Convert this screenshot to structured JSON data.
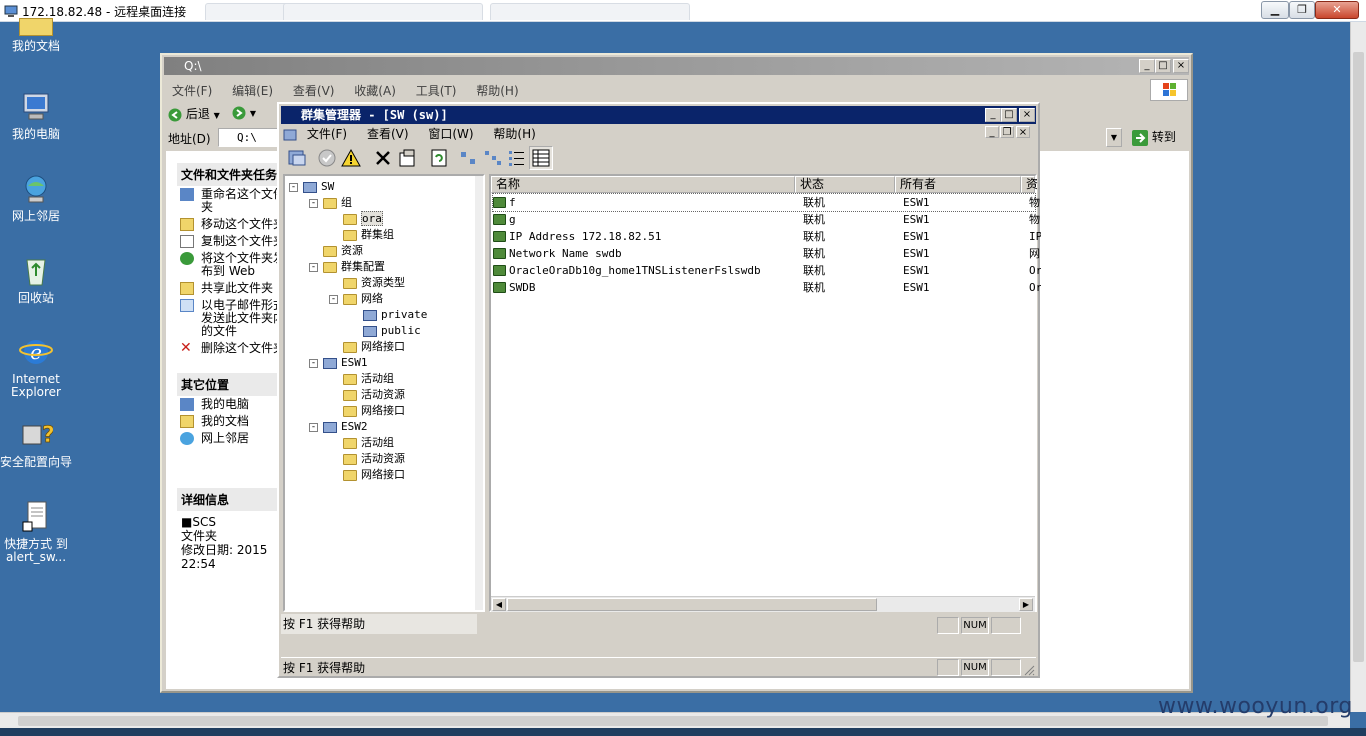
{
  "rdp": {
    "title": "172.18.82.48 - 远程桌面连接",
    "tab_count": 3
  },
  "desktop_icons": [
    {
      "label": "我的文档",
      "icon": "my-documents-icon"
    },
    {
      "label": "我的电脑",
      "icon": "my-computer-icon"
    },
    {
      "label": "网上邻居",
      "icon": "network-places-icon"
    },
    {
      "label": "回收站",
      "icon": "recycle-bin-icon"
    },
    {
      "label": "Internet Explorer",
      "icon": "ie-icon"
    },
    {
      "label": "安全配置向导",
      "icon": "security-wizard-icon"
    },
    {
      "label": "快捷方式 到 alert_sw...",
      "icon": "shortcut-file-icon"
    }
  ],
  "explorer": {
    "title": "Q:\\",
    "menu": [
      "文件(F)",
      "编辑(E)",
      "查看(V)",
      "收藏(A)",
      "工具(T)",
      "帮助(H)"
    ],
    "back_label": "后退",
    "address_label": "地址(D)",
    "address_value": "Q:\\",
    "go_label": "转到",
    "tasks_header": "文件和文件夹任务",
    "tasks": [
      "重命名这个文件夹",
      "移动这个文件夹",
      "复制这个文件夹",
      "将这个文件夹发布到 Web",
      "共享此文件夹",
      "以电子邮件形式发送此文件夹内的文件",
      "删除这个文件夹"
    ],
    "other_places_header": "其它位置",
    "other_places": [
      "我的电脑",
      "我的文档",
      "网上邻居"
    ],
    "details_header": "详细信息",
    "details_name": "■SCS",
    "details_type": "文件夹",
    "details_modified": "修改日期: 2015",
    "details_time": "22:54"
  },
  "cluster_manager": {
    "title": "群集管理器 - [SW (sw)]",
    "menu": [
      "文件(F)",
      "查看(V)",
      "窗口(W)",
      "帮助(H)"
    ],
    "tree": [
      {
        "label": "SW",
        "icon": "cluster",
        "depth": 0,
        "expander": "-"
      },
      {
        "label": "组",
        "icon": "folder",
        "depth": 1,
        "expander": "-"
      },
      {
        "label": "ora",
        "icon": "folder-group",
        "depth": 2,
        "expander": ""
      },
      {
        "label": "群集组",
        "icon": "folder-group",
        "depth": 2,
        "expander": ""
      },
      {
        "label": "资源",
        "icon": "folder",
        "depth": 1,
        "expander": ""
      },
      {
        "label": "群集配置",
        "icon": "folder",
        "depth": 1,
        "expander": "-"
      },
      {
        "label": "资源类型",
        "icon": "folder",
        "depth": 2,
        "expander": ""
      },
      {
        "label": "网络",
        "icon": "folder",
        "depth": 2,
        "expander": "-"
      },
      {
        "label": "private",
        "icon": "network",
        "depth": 3,
        "expander": ""
      },
      {
        "label": "public",
        "icon": "network",
        "depth": 3,
        "expander": ""
      },
      {
        "label": "网络接口",
        "icon": "folder",
        "depth": 2,
        "expander": ""
      },
      {
        "label": "ESW1",
        "icon": "node",
        "depth": 1,
        "expander": "-"
      },
      {
        "label": "活动组",
        "icon": "folder",
        "depth": 2,
        "expander": ""
      },
      {
        "label": "活动资源",
        "icon": "folder",
        "depth": 2,
        "expander": ""
      },
      {
        "label": "网络接口",
        "icon": "folder",
        "depth": 2,
        "expander": ""
      },
      {
        "label": "ESW2",
        "icon": "node",
        "depth": 1,
        "expander": "-"
      },
      {
        "label": "活动组",
        "icon": "folder",
        "depth": 2,
        "expander": ""
      },
      {
        "label": "活动资源",
        "icon": "folder",
        "depth": 2,
        "expander": ""
      },
      {
        "label": "网络接口",
        "icon": "folder",
        "depth": 2,
        "expander": ""
      }
    ],
    "columns": [
      "名称",
      "状态",
      "所有者",
      "资"
    ],
    "rows": [
      {
        "name": "f",
        "state": "联机",
        "owner": "ESW1",
        "type": "物"
      },
      {
        "name": "g",
        "state": "联机",
        "owner": "ESW1",
        "type": "物"
      },
      {
        "name": "IP Address 172.18.82.51",
        "state": "联机",
        "owner": "ESW1",
        "type": "IP"
      },
      {
        "name": "Network Name swdb",
        "state": "联机",
        "owner": "ESW1",
        "type": "网"
      },
      {
        "name": "OracleOraDb10g_home1TNSListenerFslswdb",
        "state": "联机",
        "owner": "ESW1",
        "type": "Or"
      },
      {
        "name": "SWDB",
        "state": "联机",
        "owner": "ESW1",
        "type": "Or"
      }
    ],
    "status_help": "按 F1 获得帮助",
    "status_num": "NUM"
  },
  "watermark": "www.wooyun.org"
}
